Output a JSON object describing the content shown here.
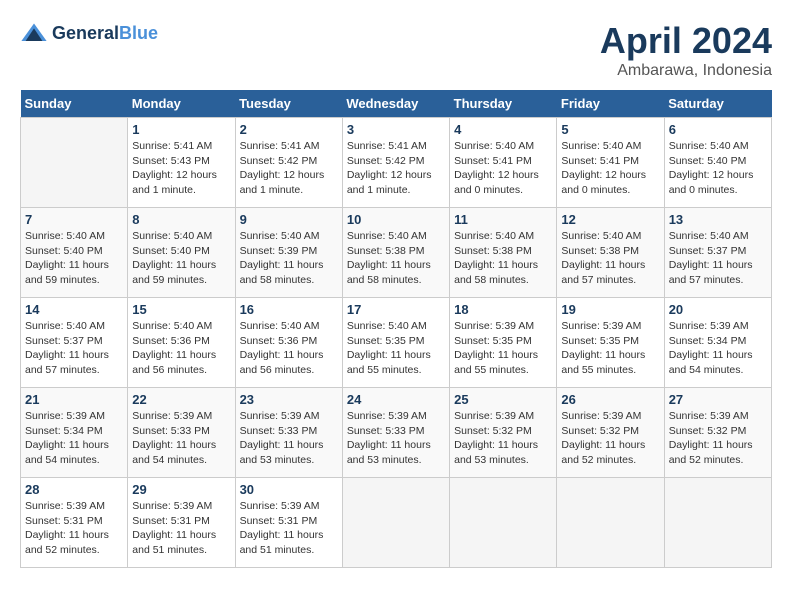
{
  "header": {
    "logo_line1": "General",
    "logo_line2": "Blue",
    "month_title": "April 2024",
    "location": "Ambarawa, Indonesia"
  },
  "days_of_week": [
    "Sunday",
    "Monday",
    "Tuesday",
    "Wednesday",
    "Thursday",
    "Friday",
    "Saturday"
  ],
  "weeks": [
    [
      {
        "day": "",
        "info": ""
      },
      {
        "day": "1",
        "info": "Sunrise: 5:41 AM\nSunset: 5:43 PM\nDaylight: 12 hours\nand 1 minute."
      },
      {
        "day": "2",
        "info": "Sunrise: 5:41 AM\nSunset: 5:42 PM\nDaylight: 12 hours\nand 1 minute."
      },
      {
        "day": "3",
        "info": "Sunrise: 5:41 AM\nSunset: 5:42 PM\nDaylight: 12 hours\nand 1 minute."
      },
      {
        "day": "4",
        "info": "Sunrise: 5:40 AM\nSunset: 5:41 PM\nDaylight: 12 hours\nand 0 minutes."
      },
      {
        "day": "5",
        "info": "Sunrise: 5:40 AM\nSunset: 5:41 PM\nDaylight: 12 hours\nand 0 minutes."
      },
      {
        "day": "6",
        "info": "Sunrise: 5:40 AM\nSunset: 5:40 PM\nDaylight: 12 hours\nand 0 minutes."
      }
    ],
    [
      {
        "day": "7",
        "info": "Sunrise: 5:40 AM\nSunset: 5:40 PM\nDaylight: 11 hours\nand 59 minutes."
      },
      {
        "day": "8",
        "info": "Sunrise: 5:40 AM\nSunset: 5:40 PM\nDaylight: 11 hours\nand 59 minutes."
      },
      {
        "day": "9",
        "info": "Sunrise: 5:40 AM\nSunset: 5:39 PM\nDaylight: 11 hours\nand 58 minutes."
      },
      {
        "day": "10",
        "info": "Sunrise: 5:40 AM\nSunset: 5:38 PM\nDaylight: 11 hours\nand 58 minutes."
      },
      {
        "day": "11",
        "info": "Sunrise: 5:40 AM\nSunset: 5:38 PM\nDaylight: 11 hours\nand 58 minutes."
      },
      {
        "day": "12",
        "info": "Sunrise: 5:40 AM\nSunset: 5:38 PM\nDaylight: 11 hours\nand 57 minutes."
      },
      {
        "day": "13",
        "info": "Sunrise: 5:40 AM\nSunset: 5:37 PM\nDaylight: 11 hours\nand 57 minutes."
      }
    ],
    [
      {
        "day": "14",
        "info": "Sunrise: 5:40 AM\nSunset: 5:37 PM\nDaylight: 11 hours\nand 57 minutes."
      },
      {
        "day": "15",
        "info": "Sunrise: 5:40 AM\nSunset: 5:36 PM\nDaylight: 11 hours\nand 56 minutes."
      },
      {
        "day": "16",
        "info": "Sunrise: 5:40 AM\nSunset: 5:36 PM\nDaylight: 11 hours\nand 56 minutes."
      },
      {
        "day": "17",
        "info": "Sunrise: 5:40 AM\nSunset: 5:35 PM\nDaylight: 11 hours\nand 55 minutes."
      },
      {
        "day": "18",
        "info": "Sunrise: 5:39 AM\nSunset: 5:35 PM\nDaylight: 11 hours\nand 55 minutes."
      },
      {
        "day": "19",
        "info": "Sunrise: 5:39 AM\nSunset: 5:35 PM\nDaylight: 11 hours\nand 55 minutes."
      },
      {
        "day": "20",
        "info": "Sunrise: 5:39 AM\nSunset: 5:34 PM\nDaylight: 11 hours\nand 54 minutes."
      }
    ],
    [
      {
        "day": "21",
        "info": "Sunrise: 5:39 AM\nSunset: 5:34 PM\nDaylight: 11 hours\nand 54 minutes."
      },
      {
        "day": "22",
        "info": "Sunrise: 5:39 AM\nSunset: 5:33 PM\nDaylight: 11 hours\nand 54 minutes."
      },
      {
        "day": "23",
        "info": "Sunrise: 5:39 AM\nSunset: 5:33 PM\nDaylight: 11 hours\nand 53 minutes."
      },
      {
        "day": "24",
        "info": "Sunrise: 5:39 AM\nSunset: 5:33 PM\nDaylight: 11 hours\nand 53 minutes."
      },
      {
        "day": "25",
        "info": "Sunrise: 5:39 AM\nSunset: 5:32 PM\nDaylight: 11 hours\nand 53 minutes."
      },
      {
        "day": "26",
        "info": "Sunrise: 5:39 AM\nSunset: 5:32 PM\nDaylight: 11 hours\nand 52 minutes."
      },
      {
        "day": "27",
        "info": "Sunrise: 5:39 AM\nSunset: 5:32 PM\nDaylight: 11 hours\nand 52 minutes."
      }
    ],
    [
      {
        "day": "28",
        "info": "Sunrise: 5:39 AM\nSunset: 5:31 PM\nDaylight: 11 hours\nand 52 minutes."
      },
      {
        "day": "29",
        "info": "Sunrise: 5:39 AM\nSunset: 5:31 PM\nDaylight: 11 hours\nand 51 minutes."
      },
      {
        "day": "30",
        "info": "Sunrise: 5:39 AM\nSunset: 5:31 PM\nDaylight: 11 hours\nand 51 minutes."
      },
      {
        "day": "",
        "info": ""
      },
      {
        "day": "",
        "info": ""
      },
      {
        "day": "",
        "info": ""
      },
      {
        "day": "",
        "info": ""
      }
    ]
  ]
}
